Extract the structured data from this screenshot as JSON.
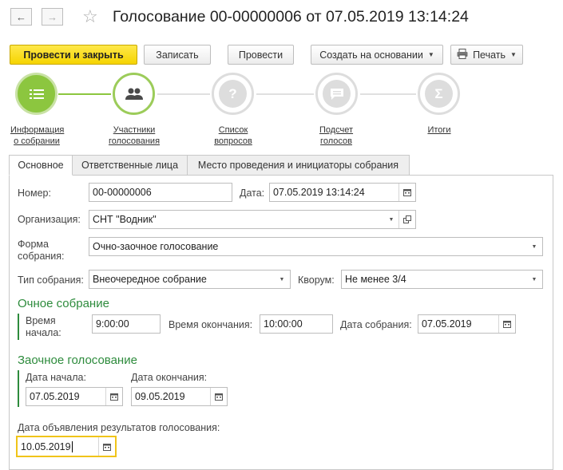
{
  "window": {
    "title": "Голосование 00-00000006 от 07.05.2019 13:14:24"
  },
  "nav": {
    "back": "←",
    "forward": "→"
  },
  "toolbar": {
    "post_close": "Провести и закрыть",
    "save": "Записать",
    "post": "Провести",
    "create_based": "Создать на основании",
    "print": "Печать"
  },
  "steps": [
    {
      "label_1": "Информация",
      "label_2": "о собрании",
      "icon": "list-icon"
    },
    {
      "label_1": "Участники",
      "label_2": "голосования",
      "icon": "people-icon"
    },
    {
      "label_1": "Список",
      "label_2": "вопросов",
      "icon": "question-icon"
    },
    {
      "label_1": "Подсчет",
      "label_2": "голосов",
      "icon": "chat-icon"
    },
    {
      "label_1": "Итоги",
      "label_2": "",
      "icon": "sigma-icon"
    }
  ],
  "tabs": [
    "Основное",
    "Ответственные лица",
    "Место проведения и инициаторы собрания"
  ],
  "form": {
    "number_label": "Номер:",
    "number_value": "00-00000006",
    "date_label": "Дата:",
    "date_value": "07.05.2019 13:14:24",
    "org_label": "Организация:",
    "org_value": "СНТ \"Водник\"",
    "form_label_1": "Форма",
    "form_label_2": "собрания:",
    "form_value": "Очно-заочное голосование",
    "type_label": "Тип собрания:",
    "type_value": "Внеочередное собрание",
    "quorum_label": "Кворум:",
    "quorum_value": "Не менее 3/4"
  },
  "fulltime": {
    "heading": "Очное собрание",
    "start_label_1": "Время",
    "start_label_2": "начала:",
    "start_value": "9:00:00",
    "end_label": "Время окончания:",
    "end_value": "10:00:00",
    "date_label": "Дата собрания:",
    "date_value": "07.05.2019"
  },
  "absentee": {
    "heading": "Заочное голосование",
    "start_label": "Дата начала:",
    "start_value": "07.05.2019",
    "end_label": "Дата окончания:",
    "end_value": "09.05.2019"
  },
  "results": {
    "label": "Дата объявления результатов голосования:",
    "value": "10.05.2019"
  }
}
